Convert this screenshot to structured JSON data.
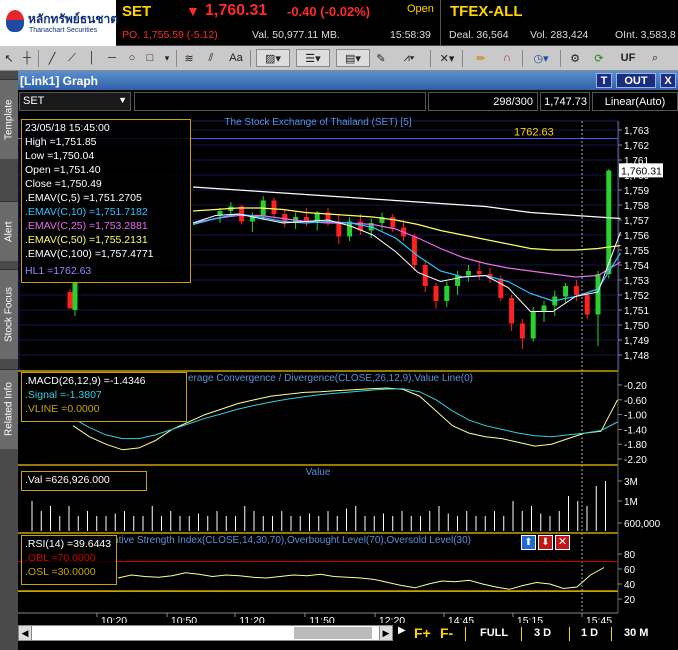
{
  "header": {
    "logo_text": "หลักทรัพย์ธนชาต",
    "logo_sub": "Thanachart Securities",
    "symbol": "SET",
    "price": "1,760.31",
    "change": "-0.40 (-0.02%)",
    "status": "Open",
    "po": "PO. 1,755.59 (-5.12)",
    "val": "Val. 50,977.11 MB.",
    "time": "15:58:39",
    "tfex": "TFEX-ALL",
    "deal": "Deal. 36,564",
    "vol": "Vol. 283,424",
    "oint": "OInt. 3,583,8"
  },
  "toolbar": {
    "uf": "UF",
    "aa": "Aa"
  },
  "side_tabs": [
    "Template",
    "Alert",
    "Stock Focus",
    "Related Info"
  ],
  "window": {
    "title": "[Link1] Graph",
    "btn_t": "T",
    "btn_out": "OUT",
    "btn_x": "X"
  },
  "topbar": {
    "symbol": "SET",
    "count": "298/300",
    "price": "1,747.73",
    "scale": "Linear(Auto)"
  },
  "price_panel": {
    "title": "The Stock Exchange of Thailand (SET) [5]",
    "hl_label": "1762.63",
    "last_tag": "1,760.31",
    "y_ticks": [
      "1,763",
      "1,762",
      "1,761",
      "1,760",
      "1,759",
      "1,758",
      "1,757",
      "1,756",
      "1,755",
      "1,754",
      "1,753",
      "1,752",
      "1,751",
      "1,750",
      "1,749",
      "1,748"
    ],
    "info": {
      "date": "23/05/18 15:45:00",
      "high": "High =1,751.85",
      "low": "Low =1,750.04",
      "open": "Open =1,751.40",
      "close": "Close =1,750.49",
      "ema5": ".EMAV(C,5) =1,751.2705",
      "ema10": ".EMAV(C,10) =1,751.7182",
      "ema25": ".EMAV(C,25) =1,753.2881",
      "ema50": ".EMAV(C,50) =1,755.2131",
      "ema100": ".EMAV(C,100) =1,757.4771",
      "hl1": "HL1 =1762.63"
    }
  },
  "macd_panel": {
    "title": "erage Convergence / Divergence(CLOSE,26,12,9),Value Line(0)",
    "macd": ".MACD(26,12,9) =-1.4346",
    "signal": ".Signal =-1.3807",
    "vline": ".VLINE =0.0000",
    "y_ticks": [
      "-0.20",
      "-0.60",
      "-1.00",
      "-1.40",
      "-1.80",
      "-2.20"
    ]
  },
  "vol_panel": {
    "title": "Value",
    "val": ".Val =626,926.000",
    "y_ticks": [
      "3M",
      "1M",
      "600,000"
    ]
  },
  "rsi_panel": {
    "title": "Relative Strength Index(CLOSE,14,30,70),Overbought Level(70),Oversold Level(30)",
    "rsi": ".RSI(14) =39.6443",
    "obl": ".OBL =70.0000",
    "osl": ".OSL =30.0000",
    "y_ticks": [
      "80",
      "60",
      "40",
      "20"
    ]
  },
  "time_axis": [
    "10:20",
    "10:50",
    "11:20",
    "11:50",
    "12:20",
    "14:45",
    "15:15",
    "15:45"
  ],
  "footer": {
    "full": "FULL",
    "d3": "3 D",
    "d1": "1 D",
    "m30": "30 M",
    "fplus": "F+",
    "fminus": "F-"
  },
  "colors": {
    "ema5": "#ffffff",
    "ema10": "#2ec4ff",
    "ema25": "#e86cf0",
    "ema50": "#ffff66",
    "ema100": "#ffffff",
    "up": "#29d12e",
    "down": "#ff2020",
    "macd": "#ffff99",
    "signal": "#33d0e0"
  }
}
